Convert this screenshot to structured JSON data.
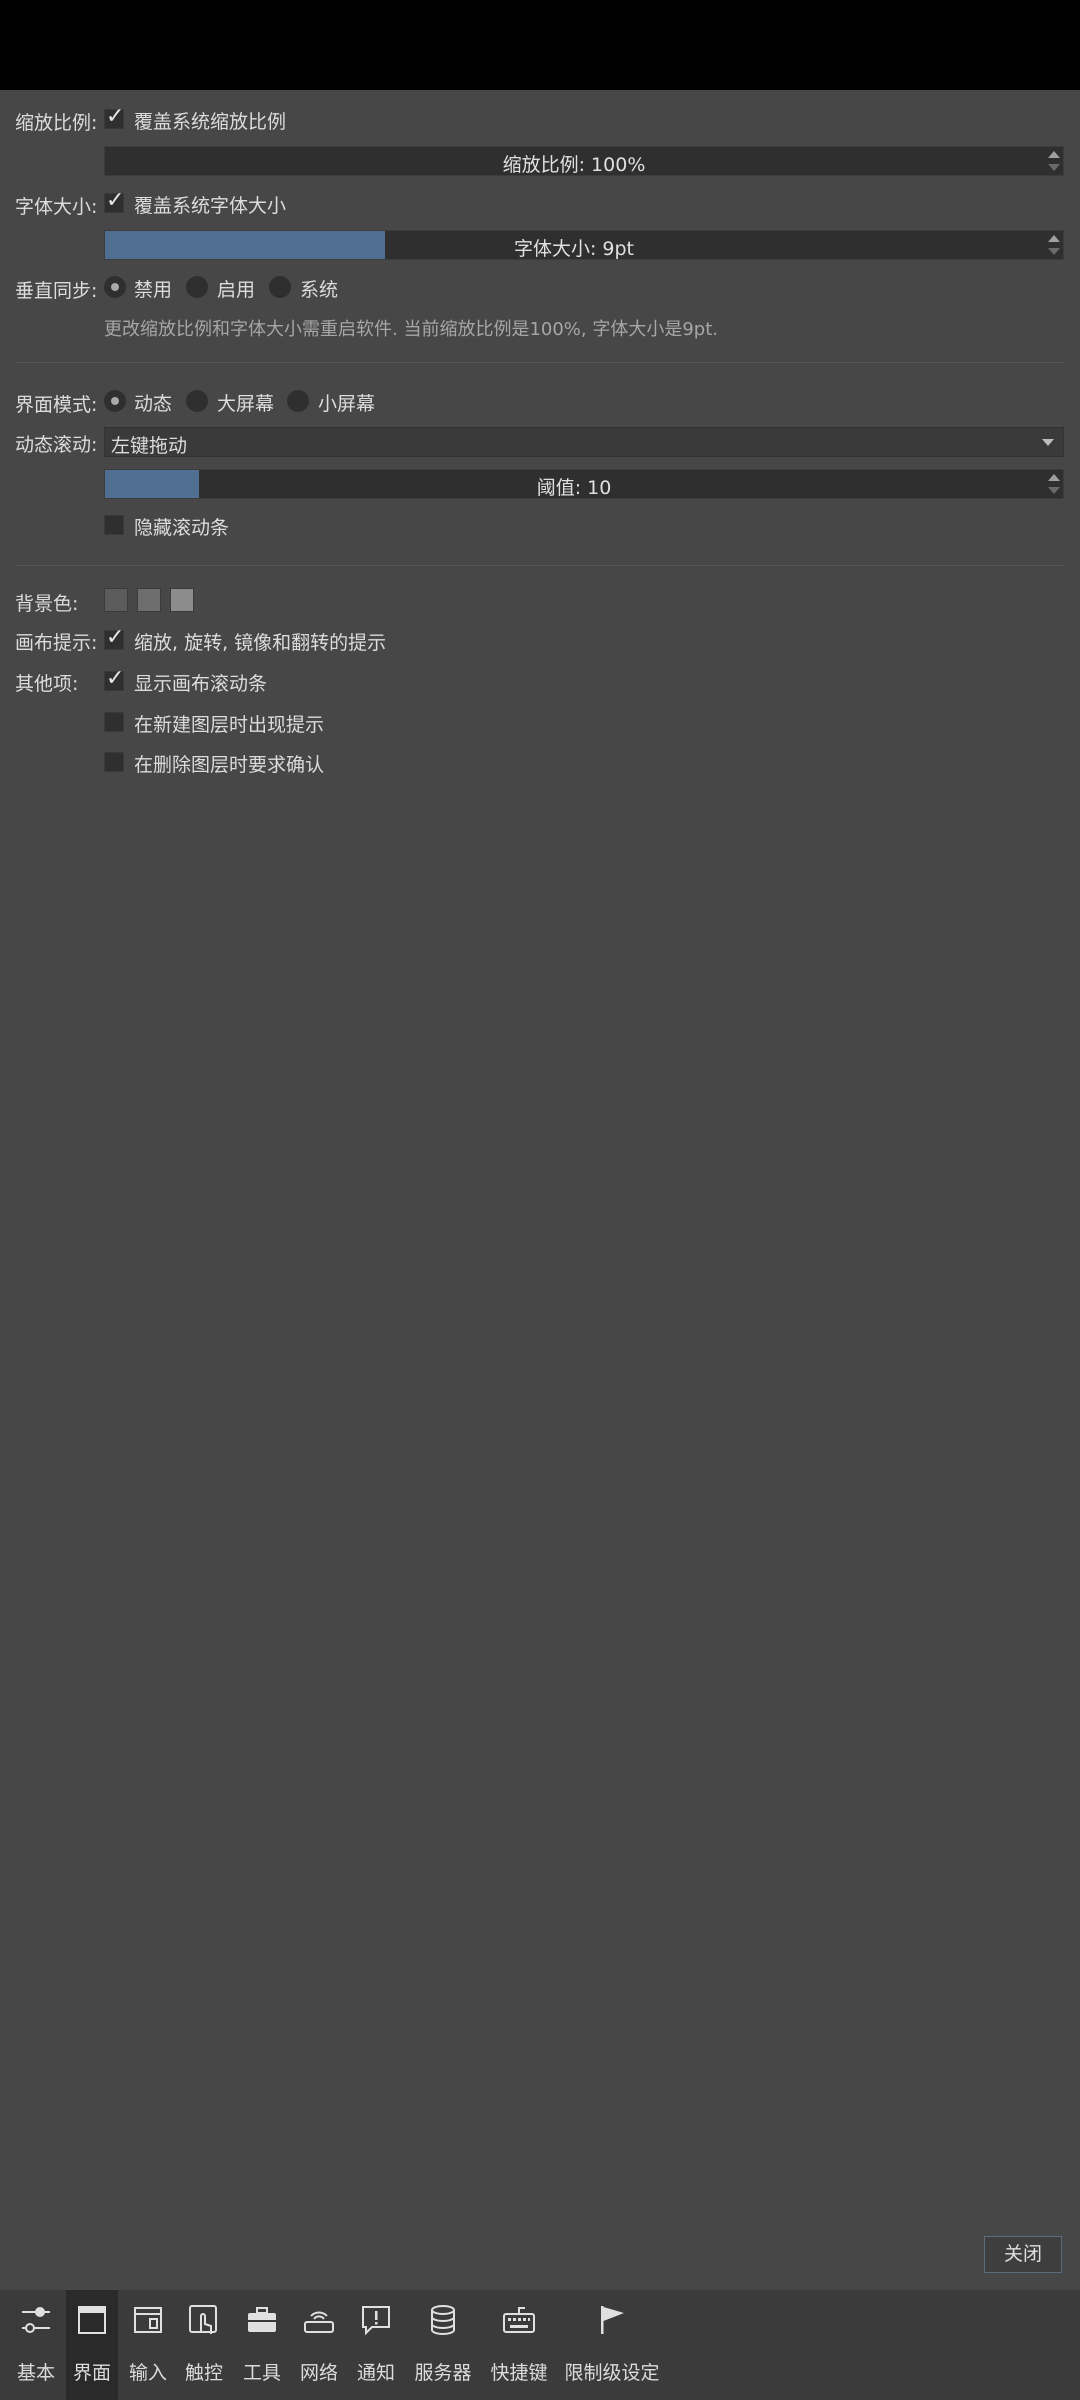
{
  "scale": {
    "label": "缩放比例:",
    "override_label": "覆盖系统缩放比例",
    "override_checked": true,
    "value_text": "缩放比例: 100%",
    "fill_fraction": 0
  },
  "font": {
    "label": "字体大小:",
    "override_label": "覆盖系统字体大小",
    "override_checked": true,
    "value_text": "字体大小: 9pt",
    "fill_fraction": 0.29
  },
  "vsync": {
    "label": "垂直同步:",
    "options": [
      "禁用",
      "启用",
      "系统"
    ],
    "selected": "禁用",
    "note": "更改缩放比例和字体大小需重启软件. 当前缩放比例是100%, 字体大小是9pt."
  },
  "ui_mode": {
    "label": "界面模式:",
    "options": [
      "动态",
      "大屏幕",
      "小屏幕"
    ],
    "selected": "动态"
  },
  "dyn_scroll": {
    "label": "动态滚动:",
    "selected": "左键拖动",
    "threshold_text": "阈值: 10",
    "threshold_fill_fraction": 0.1,
    "hide_scrollbar_label": "隐藏滚动条",
    "hide_scrollbar_checked": false
  },
  "background": {
    "label": "背景色:",
    "colors": [
      "#5c5c5c",
      "#6e6e6e",
      "#8c8c8c"
    ]
  },
  "canvas_hint": {
    "label": "画布提示:",
    "option_label": "缩放, 旋转, 镜像和翻转的提示",
    "checked": true
  },
  "other": {
    "label": "其他项:",
    "items": [
      {
        "label": "显示画布滚动条",
        "checked": true
      },
      {
        "label": "在新建图层时出现提示",
        "checked": false
      },
      {
        "label": "在删除图层时要求确认",
        "checked": false
      }
    ]
  },
  "close_button": "关闭",
  "nav": {
    "active": "界面",
    "items": [
      {
        "label": "基本",
        "icon": "sliders-icon"
      },
      {
        "label": "界面",
        "icon": "window-icon"
      },
      {
        "label": "输入",
        "icon": "input-window-icon"
      },
      {
        "label": "触控",
        "icon": "touch-icon"
      },
      {
        "label": "工具",
        "icon": "toolbox-icon"
      },
      {
        "label": "网络",
        "icon": "router-icon"
      },
      {
        "label": "通知",
        "icon": "notification-icon"
      },
      {
        "label": "服务器",
        "icon": "database-icon"
      },
      {
        "label": "快捷键",
        "icon": "keyboard-icon"
      },
      {
        "label": "限制级设定",
        "icon": "flag-icon"
      }
    ]
  }
}
